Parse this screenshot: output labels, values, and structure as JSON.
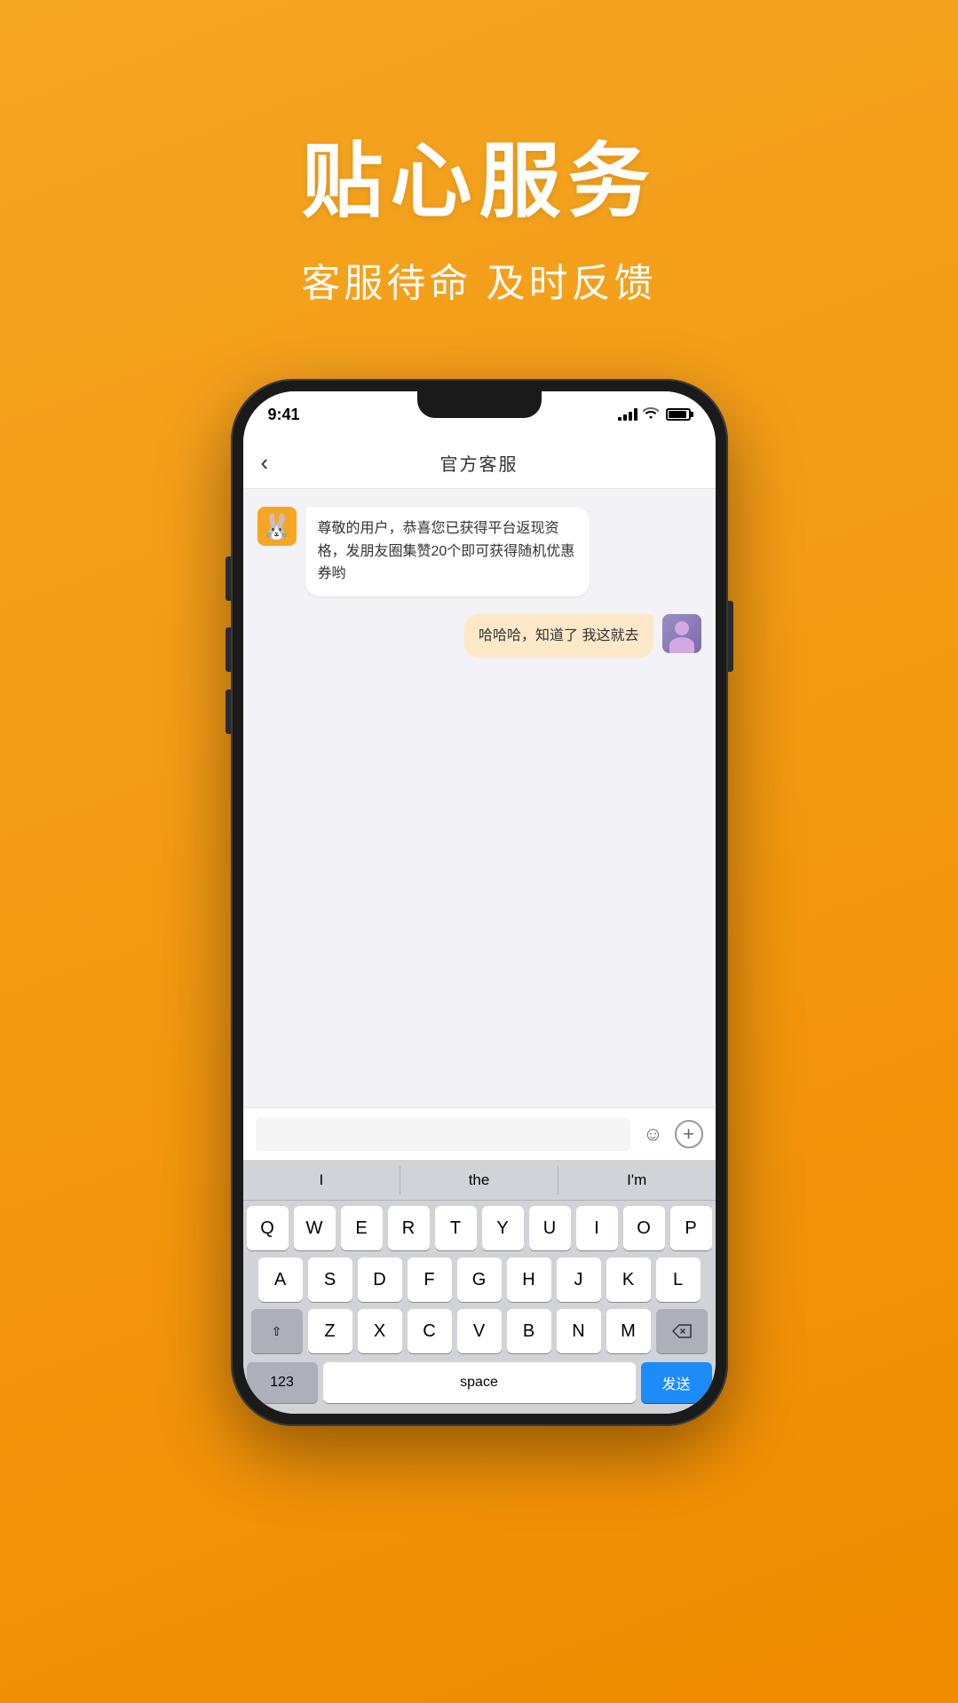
{
  "background": {
    "gradient_start": "#f5a623",
    "gradient_end": "#f08c00"
  },
  "top_section": {
    "main_title": "贴心服务",
    "sub_title": "客服待命 及时反馈"
  },
  "status_bar": {
    "time": "9:41",
    "signal": "signal-icon",
    "wifi": "wifi-icon",
    "battery": "battery-icon"
  },
  "nav": {
    "title": "官方客服",
    "back_label": "‹"
  },
  "messages": [
    {
      "id": "msg1",
      "side": "left",
      "text": "尊敬的用户，恭喜您已获得平台返现资格，发朋友圈集赞20个即可获得随机优惠券哟",
      "avatar": "service-avatar"
    },
    {
      "id": "msg2",
      "side": "right",
      "text": "哈哈哈，知道了 我这就去",
      "avatar": "user-avatar"
    }
  ],
  "input": {
    "placeholder": "",
    "emoji_label": "😊",
    "plus_label": "+"
  },
  "keyboard": {
    "suggestions": [
      "I",
      "the",
      "I'm"
    ],
    "rows": [
      [
        "Q",
        "W",
        "E",
        "R",
        "T",
        "Y",
        "U",
        "I",
        "O",
        "P"
      ],
      [
        "A",
        "S",
        "D",
        "F",
        "G",
        "H",
        "J",
        "K",
        "L"
      ],
      [
        "⇧",
        "Z",
        "X",
        "C",
        "V",
        "B",
        "N",
        "M",
        "⌫"
      ]
    ],
    "bottom": {
      "numbers_label": "123",
      "space_label": "space",
      "send_label": "发送"
    }
  }
}
